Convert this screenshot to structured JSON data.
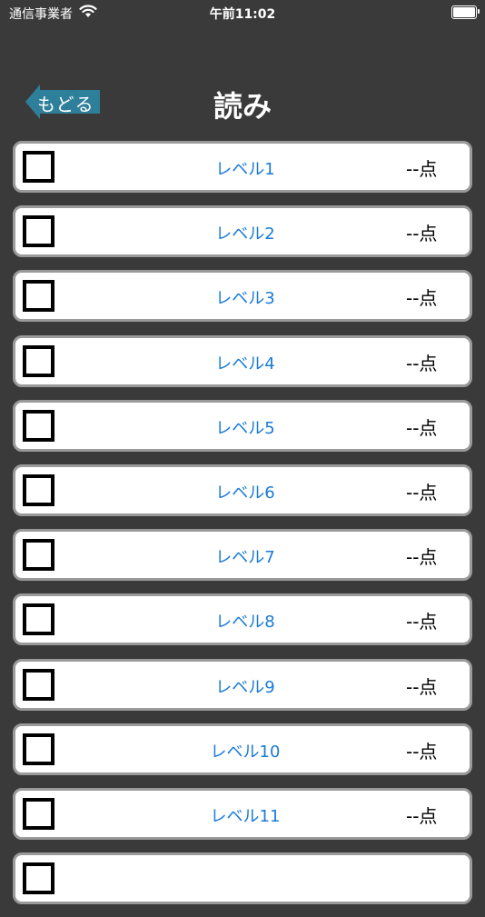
{
  "status_bar": {
    "carrier": "通信事業者",
    "time": "午前11:02"
  },
  "nav": {
    "back_label": "もどる",
    "title": "読み"
  },
  "colors": {
    "background": "#3a3a3a",
    "back_button": "#2e7f99",
    "level_text": "#1a7ad6"
  },
  "levels": [
    {
      "label": "レベル1",
      "score": "--点",
      "checked": false
    },
    {
      "label": "レベル2",
      "score": "--点",
      "checked": false
    },
    {
      "label": "レベル3",
      "score": "--点",
      "checked": false
    },
    {
      "label": "レベル4",
      "score": "--点",
      "checked": false
    },
    {
      "label": "レベル5",
      "score": "--点",
      "checked": false
    },
    {
      "label": "レベル6",
      "score": "--点",
      "checked": false
    },
    {
      "label": "レベル7",
      "score": "--点",
      "checked": false
    },
    {
      "label": "レベル8",
      "score": "--点",
      "checked": false
    },
    {
      "label": "レベル9",
      "score": "--点",
      "checked": false
    },
    {
      "label": "レベル10",
      "score": "--点",
      "checked": false
    },
    {
      "label": "レベル11",
      "score": "--点",
      "checked": false
    },
    {
      "label": "",
      "score": "",
      "checked": false
    }
  ]
}
